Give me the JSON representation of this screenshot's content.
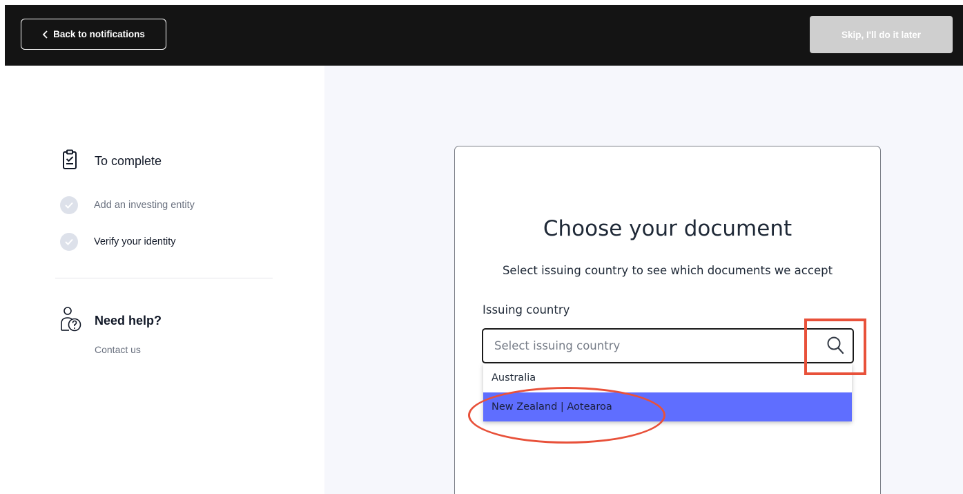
{
  "header": {
    "back_label": "Back to notifications",
    "skip_label": "Skip, I'll do it later"
  },
  "sidebar": {
    "todo_title": "To complete",
    "steps": [
      {
        "label": "Add an investing entity",
        "state": "done"
      },
      {
        "label": "Verify your identity",
        "state": "current"
      }
    ],
    "help_title": "Need help?",
    "contact_label": "Contact us"
  },
  "main": {
    "title": "Choose your document",
    "subtitle": "Select issuing country to see which documents we accept",
    "field_label": "Issuing country",
    "search_placeholder": "Select issuing country",
    "options": [
      "Australia",
      "New Zealand | Aotearoa"
    ],
    "highlighted_option": "New Zealand | Aotearoa"
  },
  "colors": {
    "header_bg": "#141414",
    "highlight": "#5f6eff",
    "annotation": "#e8513a"
  },
  "icons": [
    "chevron-left-icon",
    "clipboard-check-icon",
    "check-icon",
    "help-person-icon",
    "search-icon"
  ]
}
